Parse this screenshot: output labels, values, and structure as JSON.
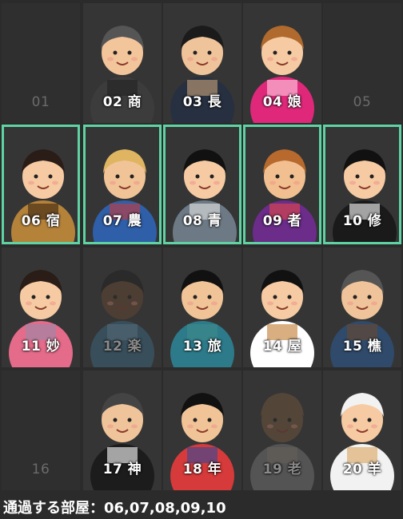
{
  "rooms": [
    {
      "label": "01",
      "type": "empty",
      "skin": "#000",
      "hair": "#000",
      "shirt": "#000"
    },
    {
      "label": "02 商",
      "type": "filled",
      "skin": "#f3c59b",
      "hair": "#555",
      "shirt": "#3c3c3c",
      "accent": "#222"
    },
    {
      "label": "03 長",
      "type": "filled",
      "skin": "#f0c49a",
      "hair": "#1b1b1b",
      "shirt": "#273040",
      "accent": "#c9a27a"
    },
    {
      "label": "04 娘",
      "type": "filled",
      "skin": "#f6cba3",
      "hair": "#b06a2e",
      "shirt": "#e0287b",
      "accent": "#ffd2e6"
    },
    {
      "label": "05",
      "type": "empty",
      "skin": "#000",
      "hair": "#000",
      "shirt": "#000"
    },
    {
      "label": "06 宿",
      "type": "filled",
      "skin": "#f6cba3",
      "hair": "#2a1c16",
      "shirt": "#b5823a",
      "accent": "#3a2412"
    },
    {
      "label": "07 農",
      "type": "filled",
      "skin": "#f1c498",
      "hair": "#e0b562",
      "shirt": "#2f5fa8",
      "accent": "#c83a3a"
    },
    {
      "label": "08 青",
      "type": "filled",
      "skin": "#f6cba3",
      "hair": "#111",
      "shirt": "#6d7a86",
      "accent": "#e5e5e5"
    },
    {
      "label": "09 者",
      "type": "filled",
      "skin": "#f2c090",
      "hair": "#b86a2e",
      "shirt": "#6b2c8a",
      "accent": "#e24848"
    },
    {
      "label": "10 修",
      "type": "filled",
      "skin": "#f6cba3",
      "hair": "#111",
      "shirt": "#1a1a1a",
      "accent": "#ffffff"
    },
    {
      "label": "11 妙",
      "type": "filled",
      "skin": "#f6cba3",
      "hair": "#2a1c16",
      "shirt": "#e46b8a",
      "accent": "#9a88a8"
    },
    {
      "label": "12 楽",
      "type": "dim",
      "skin": "#6a4a32",
      "hair": "#1d1d1d",
      "shirt": "#3d6d8a",
      "accent": "#7aa8c0"
    },
    {
      "label": "13 旅",
      "type": "filled",
      "skin": "#f1c498",
      "hair": "#111",
      "shirt": "#2d7a8a",
      "accent": "#3e8a8c"
    },
    {
      "label": "14 屋",
      "type": "filled",
      "skin": "#f6cba3",
      "hair": "#111",
      "shirt": "#ffffff",
      "accent": "#c07a2e"
    },
    {
      "label": "15 樵",
      "type": "filled",
      "skin": "#f0c49a",
      "hair": "#555",
      "shirt": "#2f4a6a",
      "accent": "#6b4a2e"
    },
    {
      "label": "16",
      "type": "empty",
      "skin": "#000",
      "hair": "#000",
      "shirt": "#000"
    },
    {
      "label": "17 神",
      "type": "filled",
      "skin": "#f0c49a",
      "hair": "#444",
      "shirt": "#1c1c1c",
      "accent": "#ffffff"
    },
    {
      "label": "18 年",
      "type": "filled",
      "skin": "#f1c498",
      "hair": "#111",
      "shirt": "#d63a3a",
      "accent": "#2f4a9a"
    },
    {
      "label": "19 老",
      "type": "dim",
      "skin": "#7a5a3e",
      "hair": "#7a5a3e",
      "shirt": "#7a7a7a",
      "accent": "#a09080"
    },
    {
      "label": "20 羊",
      "type": "filled",
      "skin": "#f6cba3",
      "hair": "#f2f2f2",
      "shirt": "#f2f2f2",
      "accent": "#d9a35a"
    }
  ],
  "highlighted": [
    5,
    6,
    7,
    8,
    9
  ],
  "footer": "通過する部屋：06,07,08,09,10",
  "colors": {
    "highlight": "#5fd3a3",
    "background": "#2b2b2b",
    "cell": "#353535"
  }
}
